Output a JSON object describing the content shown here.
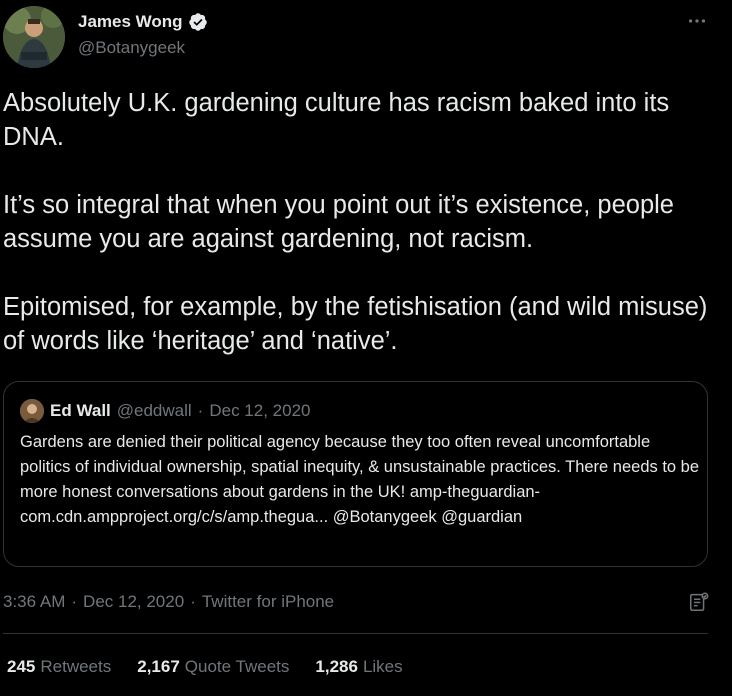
{
  "author": {
    "display_name": "James Wong",
    "handle": "@Botanygeek",
    "verified": true
  },
  "tweet": {
    "paragraphs": [
      "Absolutely U.K. gardening culture has racism baked into its DNA.",
      "It’s so integral that when you point out it’s existence, people assume you are against gardening, not racism.",
      "Epitomised, for example, by the fetishisation (and wild misuse) of words like ‘heritage’ and ‘native’."
    ]
  },
  "quoted_tweet": {
    "display_name": "Ed Wall",
    "handle": "@eddwall",
    "separator": "·",
    "date": "Dec 12, 2020",
    "text": "Gardens are denied their political agency because they too often reveal uncomfortable politics of individual ownership, spatial inequity, & unsustainable practices. There needs to be more honest conversations about gardens in the UK! amp-theguardian-com.cdn.ampproject.org/c/s/amp.thegua... @Botanygeek @guardian"
  },
  "meta": {
    "time": "3:36 AM",
    "separator": "·",
    "date": "Dec 12, 2020",
    "source": "Twitter for iPhone"
  },
  "stats": {
    "retweets_count": "245",
    "retweets_label": "Retweets",
    "quotes_count": "2,167",
    "quotes_label": "Quote Tweets",
    "likes_count": "1,286",
    "likes_label": "Likes"
  },
  "icons": {
    "more": "more-options-icon",
    "verified": "verified-badge-icon",
    "analytics": "analytics-icon"
  },
  "colors": {
    "background": "#000000",
    "text": "#e7e9ea",
    "secondary": "#71767b",
    "verified": "#1d9bf0",
    "border": "#2f3336"
  }
}
